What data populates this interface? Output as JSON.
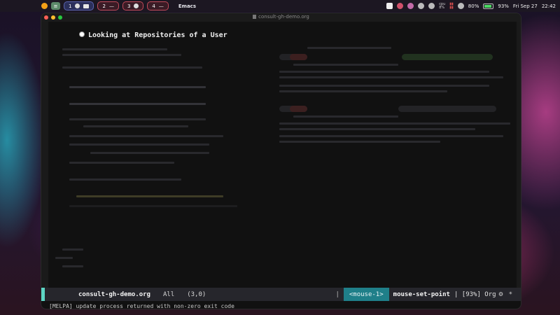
{
  "menubar": {
    "workspaces": [
      {
        "number": "1"
      },
      {
        "number": "2",
        "label": "—"
      },
      {
        "number": "3"
      },
      {
        "number": "4",
        "label": "—"
      }
    ],
    "app_name": "Emacs",
    "cpu_label": "cpu",
    "cpu_value": "8%",
    "volume": "80%",
    "battery": "93%",
    "battery_level": 0.93,
    "date": "Fri Sep 27",
    "time": "22:42"
  },
  "window": {
    "title": "consult-gh-demo.org",
    "heading": "Looking at Repositories of a User"
  },
  "modeline": {
    "filename": "consult-gh-demo.org",
    "position": "All",
    "line_col": "(3,0)",
    "pipe": "|",
    "mouse_event": "<mouse-1>",
    "command": "mouse-set-point",
    "status": "| [93%] Org",
    "gear": "⚙",
    "star": "*"
  },
  "colors": {
    "modeline_accent": "#5dd5c4",
    "mouse_bg": "#1f7f89"
  },
  "echo_area": {
    "message": "[MELPA] update process returned with non-zero exit code"
  }
}
